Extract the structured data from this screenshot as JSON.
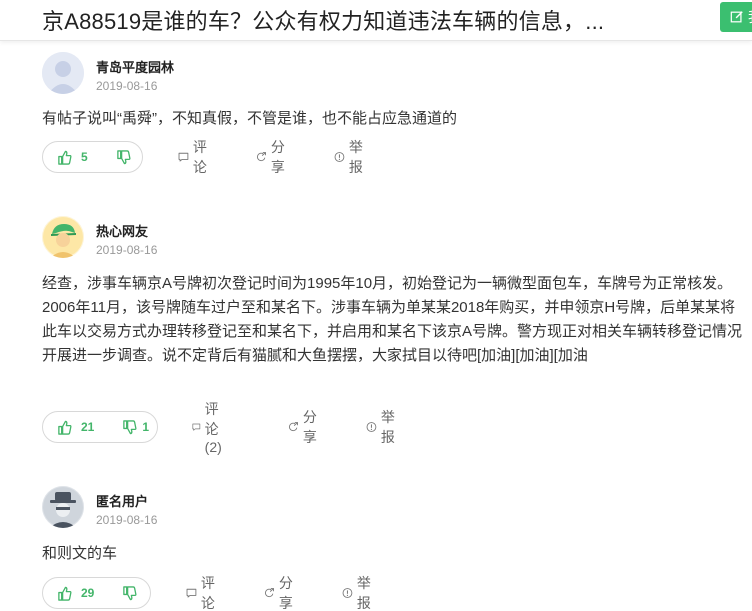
{
  "header": {
    "title": "京A88519是谁的车？公众有权力知道违法车辆的信息，...",
    "answer_label": "我"
  },
  "comments": [
    {
      "username": "青岛平度园林",
      "date": "2019-08-16",
      "content": "有帖子说叫“禹舜”，不知真假，不管是谁，也不能占应急通道的",
      "likes": "5",
      "dislikes": "",
      "comment_label": "评论",
      "share_label": "分享",
      "report_label": "举报"
    },
    {
      "username": "热心网友",
      "date": "2019-08-16",
      "content": "经查，涉事车辆京A号牌初次登记时间为1995年10月，初始登记为一辆微型面包车，车牌号为正常核发。2006年11月，该号牌随车过户至和某名下。涉事车辆为单某某2018年购买，并申领京H号牌，后单某某将此车以交易方式办理转移登记至和某名下，并启用和某名下该京A号牌。警方现正对相关车辆转移登记情况开展进一步调查。说不定背后有猫腻和大鱼摆摆，大家拭目以待吧[加油][加油][加油",
      "likes": "21",
      "dislikes": "1",
      "comment_label": "评论(2)",
      "share_label": "分享",
      "report_label": "举报"
    },
    {
      "username": "匿名用户",
      "date": "2019-08-16",
      "content": "和则文的车",
      "likes": "29",
      "dislikes": "",
      "comment_label": "评论",
      "share_label": "分享",
      "report_label": "举报"
    }
  ],
  "colors": {
    "accent_green": "#43b56a",
    "answer_button": "#3bbf70"
  },
  "icons": [
    "edit-icon",
    "thumbs-up-icon",
    "thumbs-down-icon",
    "comment-icon",
    "share-icon",
    "report-icon"
  ]
}
